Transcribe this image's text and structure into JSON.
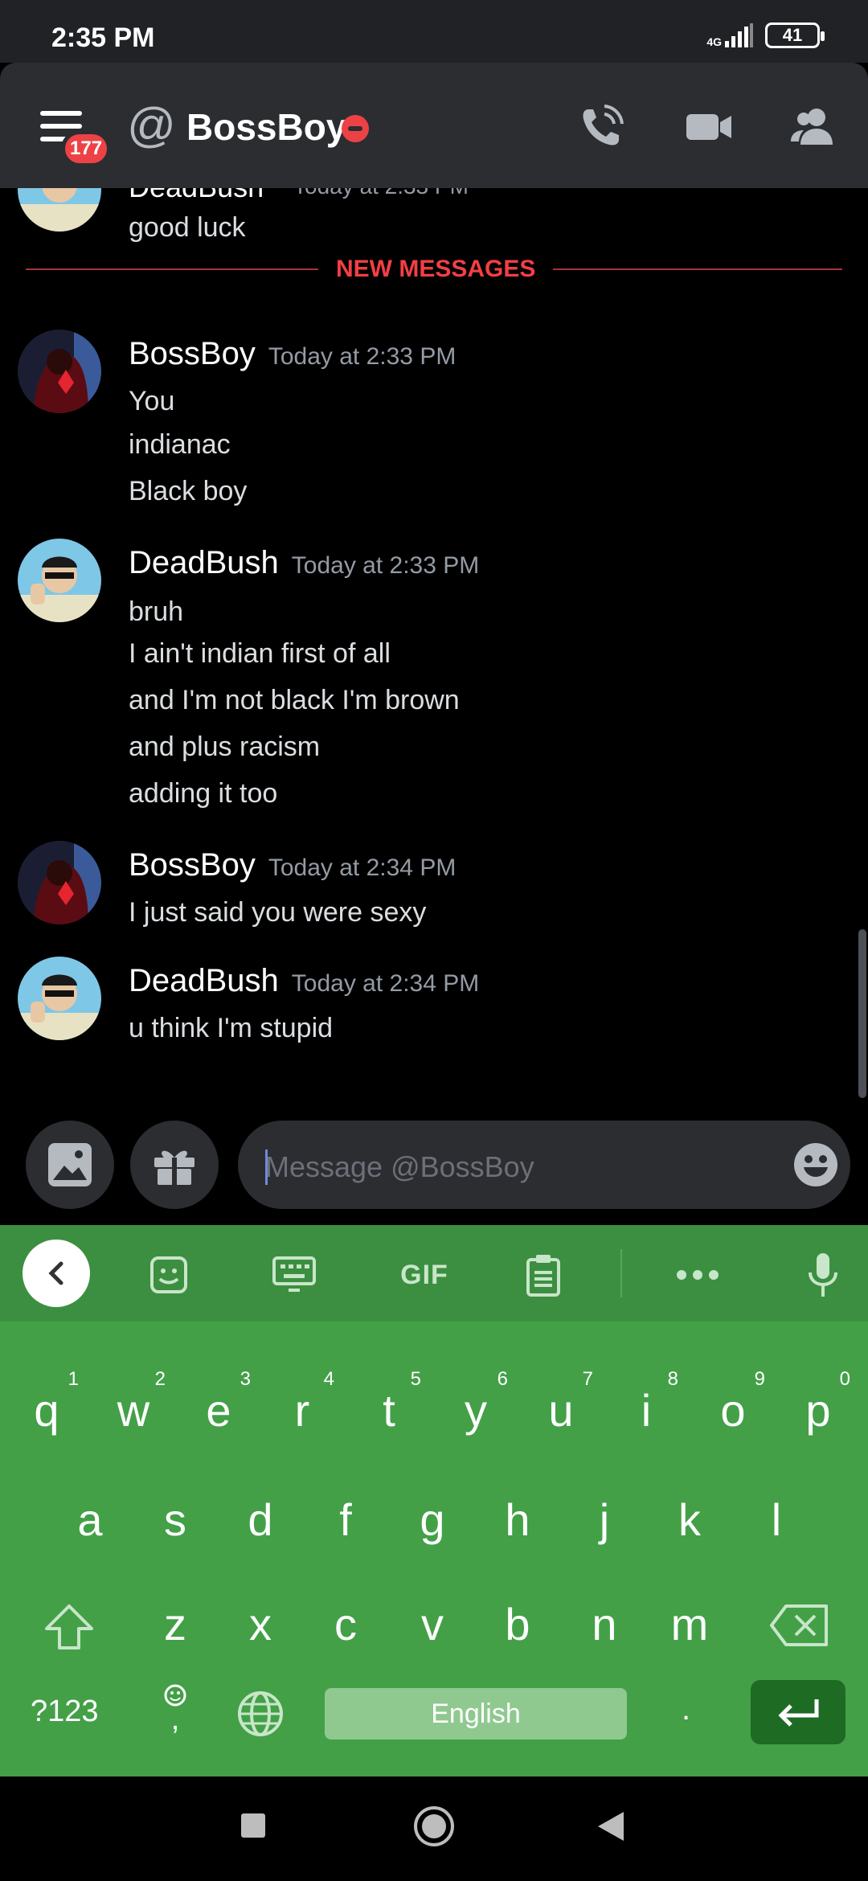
{
  "status_bar": {
    "time": "2:35 PM",
    "network": "4G",
    "battery": "41"
  },
  "header": {
    "badge_count": "177",
    "title": "BossBoy",
    "status": "do-not-disturb",
    "icons": [
      "menu-icon",
      "at-icon",
      "voice-call-icon",
      "video-call-icon",
      "members-icon"
    ]
  },
  "chat": {
    "partial_message": {
      "author": "DeadBush",
      "time": "Today at 2:33 PM",
      "text": "good luck"
    },
    "new_messages_label": "NEW MESSAGES",
    "groups": [
      {
        "author": "BossBoy",
        "time": "Today at 2:33 PM",
        "lines": [
          "You",
          "indianac",
          "Black boy"
        ]
      },
      {
        "author": "DeadBush",
        "time": "Today at 2:33 PM",
        "lines": [
          "bruh",
          "I ain't indian first of all",
          "and I'm not black I'm brown",
          "and plus racism",
          "adding it too"
        ]
      },
      {
        "author": "BossBoy",
        "time": "Today at 2:34 PM",
        "lines": [
          "I just said you were sexy"
        ]
      },
      {
        "author": "DeadBush",
        "time": "Today at 2:34 PM",
        "lines": [
          "u think I'm stupid"
        ]
      }
    ]
  },
  "composer": {
    "placeholder": "Message @BossBoy"
  },
  "keyboard": {
    "toolbar_gif": "GIF",
    "row1": [
      "q",
      "w",
      "e",
      "r",
      "t",
      "y",
      "u",
      "i",
      "o",
      "p"
    ],
    "row1_hints": [
      "1",
      "2",
      "3",
      "4",
      "5",
      "6",
      "7",
      "8",
      "9",
      "0"
    ],
    "row2": [
      "a",
      "s",
      "d",
      "f",
      "g",
      "h",
      "j",
      "k",
      "l"
    ],
    "row3": [
      "z",
      "x",
      "c",
      "v",
      "b",
      "n",
      "m"
    ],
    "symbols_label": "?123",
    "comma": ",",
    "space_label": "English",
    "period": "."
  },
  "colors": {
    "accent_red": "#ed4245",
    "keyboard_green": "#43a047",
    "header_bg": "#2b2d31"
  }
}
